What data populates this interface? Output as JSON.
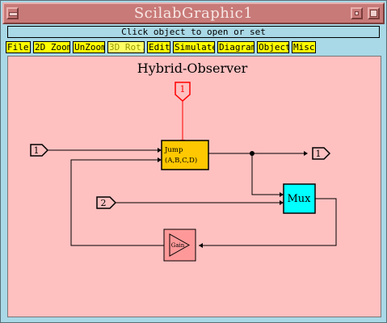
{
  "window": {
    "title": "ScilabGraphic1"
  },
  "status": {
    "message": "Click object to open or set"
  },
  "menus": [
    {
      "label": "File"
    },
    {
      "label": "2D Zoom"
    },
    {
      "label": "UnZoom"
    },
    {
      "label": "3D Rot."
    },
    {
      "label": "Edit"
    },
    {
      "label": "Simulate"
    },
    {
      "label": "Diagram"
    },
    {
      "label": "Object"
    },
    {
      "label": "Misc"
    }
  ],
  "diagram": {
    "title": "Hybrid-Observer",
    "blocks": {
      "jump": {
        "line1": "Jump",
        "line2": "(A,B,C,D)"
      },
      "mux": {
        "label": "Mux"
      },
      "gain": {
        "label": "Gain"
      }
    },
    "ports": {
      "event_in": "1",
      "in1": "1",
      "in2": "2",
      "out1": "1"
    },
    "colors": {
      "background": "#ffc0c0",
      "jump_fill": "#ffc800",
      "mux_fill": "#00ffff",
      "gain_fill": "#ff9999",
      "event_link": "#ff0000"
    }
  }
}
